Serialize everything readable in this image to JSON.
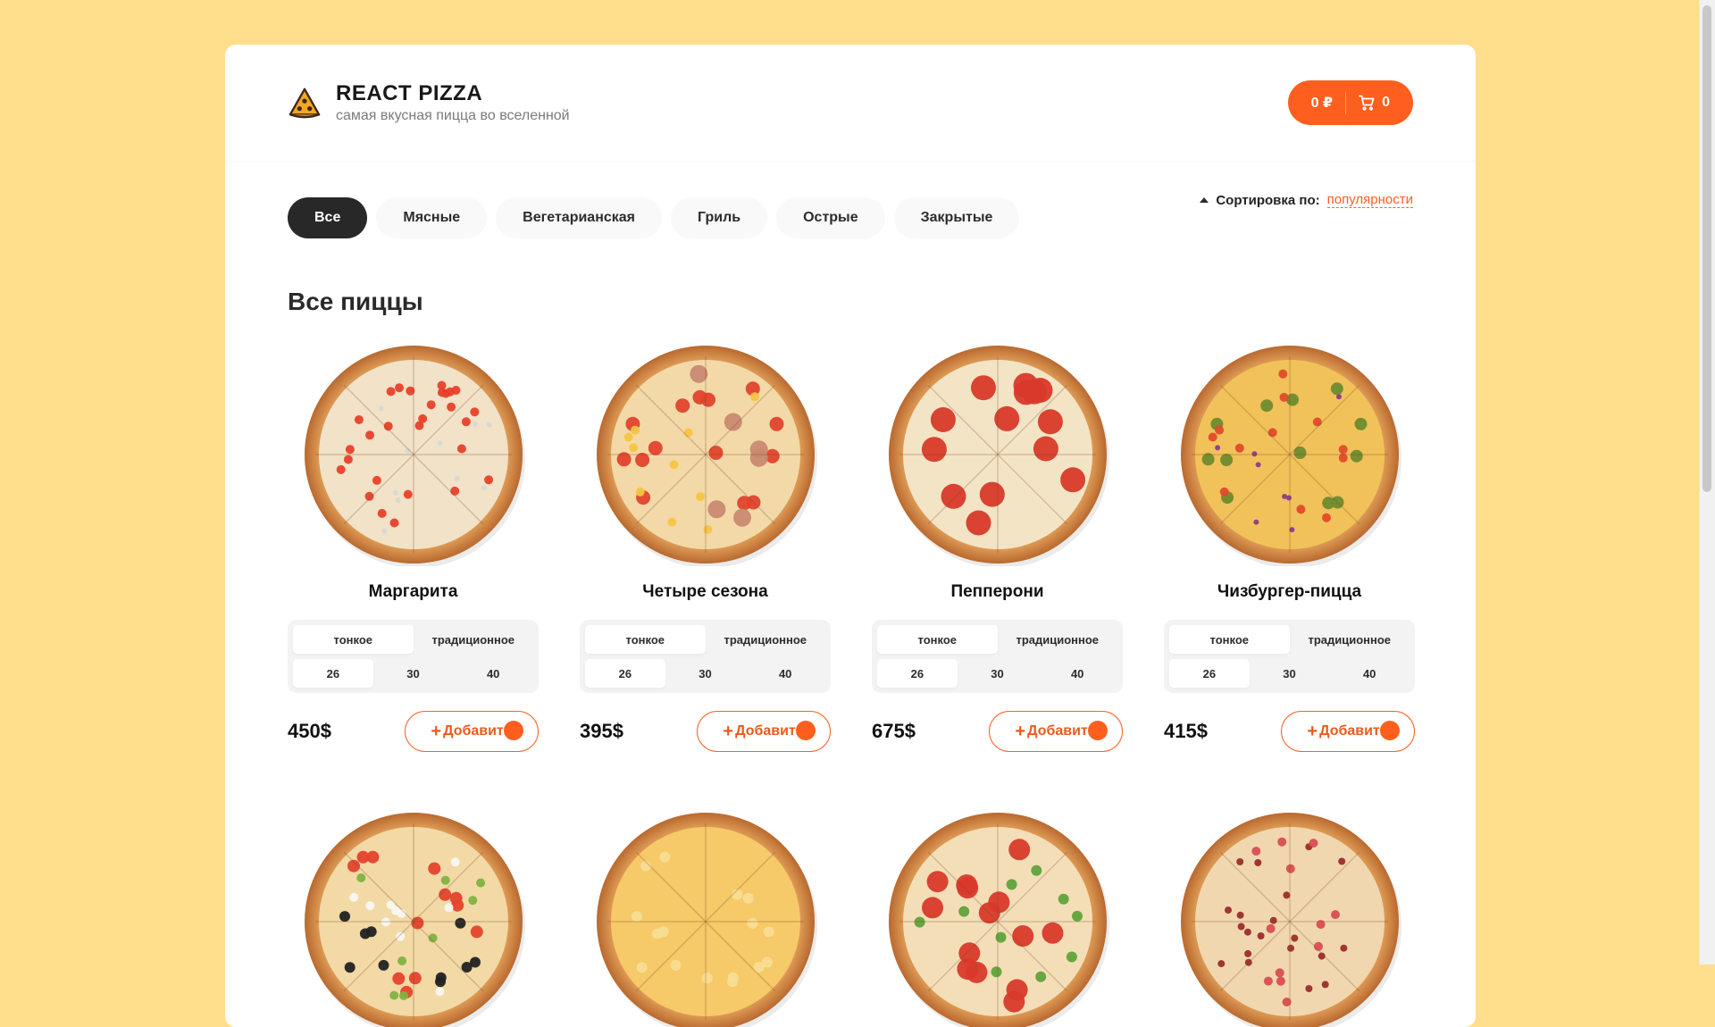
{
  "header": {
    "title": "REACT PIZZA",
    "subtitle": "самая вкусная пицца во вселенной",
    "cart_total": "0 ₽",
    "cart_count": "0"
  },
  "categories": [
    "Все",
    "Мясные",
    "Вегетарианская",
    "Гриль",
    "Острые",
    "Закрытые"
  ],
  "active_category": 0,
  "sort": {
    "label": "Сортировка по:",
    "value": "популярности"
  },
  "section_title": "Все пиццы",
  "dough_types": [
    "тонкое",
    "традиционное"
  ],
  "sizes": [
    "26",
    "30",
    "40"
  ],
  "add_label": "Добавить",
  "colors": {
    "accent": "#FE5F1E",
    "background": "#FFDF8C"
  },
  "pizzas": [
    {
      "name": "Маргарита",
      "price": "450$",
      "style": "margarita"
    },
    {
      "name": "Четыре сезона",
      "price": "395$",
      "style": "four-seasons"
    },
    {
      "name": "Пепперони",
      "price": "675$",
      "style": "pepperoni"
    },
    {
      "name": "Чизбургер-пицца",
      "price": "415$",
      "style": "cheeseburger"
    }
  ],
  "partial_pizzas": [
    {
      "style": "veggie"
    },
    {
      "style": "cheese"
    },
    {
      "style": "pepperoni-pepper"
    },
    {
      "style": "bbq"
    }
  ]
}
